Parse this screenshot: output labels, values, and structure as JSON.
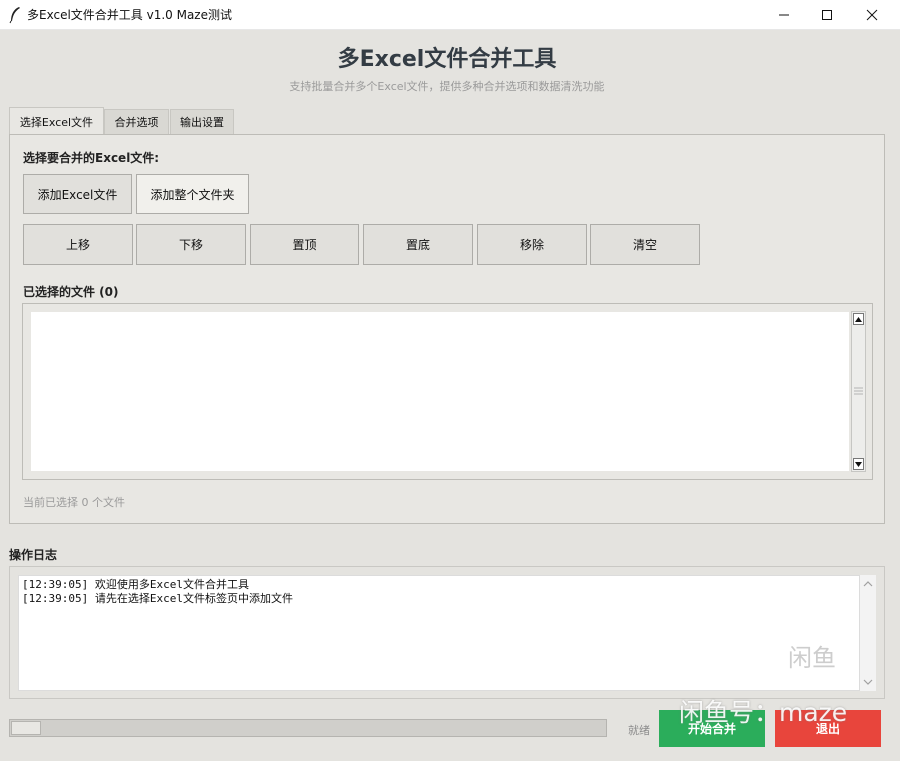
{
  "window": {
    "title": "多Excel文件合并工具 v1.0 Maze测试",
    "min_icon": "minimize-icon",
    "max_icon": "maximize-icon",
    "close_icon": "close-icon"
  },
  "header": {
    "title": "多Excel文件合并工具",
    "subtitle": "支持批量合并多个Excel文件，提供多种合并选项和数据清洗功能"
  },
  "tabs": [
    {
      "label": "选择Excel文件",
      "active": true
    },
    {
      "label": "合并选项",
      "active": false
    },
    {
      "label": "输出设置",
      "active": false
    }
  ],
  "select_panel": {
    "heading": "选择要合并的Excel文件:",
    "add_files_label": "添加Excel文件",
    "add_folder_label": "添加整个文件夹",
    "order_buttons": [
      "上移",
      "下移",
      "置顶",
      "置底",
      "移除",
      "清空"
    ],
    "selected_files_label": "已选择的文件 (0)",
    "files": [],
    "count_text": "当前已选择 0 个文件"
  },
  "log": {
    "label": "操作日志",
    "lines": [
      "[12:39:05] 欢迎使用多Excel文件合并工具",
      "[12:39:05] 请先在选择Excel文件标签页中添加文件"
    ]
  },
  "footer": {
    "progress": 0.05,
    "status": "就绪",
    "start_label": "开始合并",
    "exit_label": "退出"
  },
  "watermark": {
    "badge": "闲鱼",
    "text": "闲鱼号：maze"
  },
  "colors": {
    "start_button": "#2bad5b",
    "exit_button": "#e8453c",
    "title_text": "#333c44"
  }
}
